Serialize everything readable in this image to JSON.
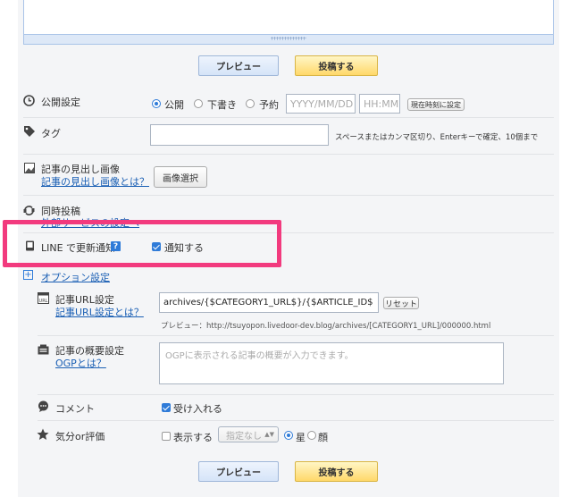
{
  "buttons": {
    "preview": "プレビュー",
    "post": "投稿する"
  },
  "publish": {
    "label": "公開設定",
    "options": [
      "公開",
      "下書き",
      "予約"
    ],
    "selected": "公開",
    "date_placeholder": "YYYY/MM/DD",
    "time_placeholder": "HH:MM",
    "now_button": "現在時刻に設定"
  },
  "tag": {
    "label": "タグ",
    "value": "",
    "hint": "スペースまたはカンマ区切り、Enterキーで確定、10個まで"
  },
  "heading_image": {
    "label": "記事の見出し画像",
    "link": "記事の見出し画像とは？",
    "button": "画像選択"
  },
  "sync_post": {
    "label": "同時投稿",
    "link": "外部サービスの設定へ"
  },
  "line": {
    "label": "LINE で更新通知",
    "help": "?",
    "checkbox_label": "通知する",
    "checked": true
  },
  "options": {
    "toggle": "+",
    "link": "オプション設定"
  },
  "article_url": {
    "label": "記事URL設定",
    "link": "記事URL設定とは？",
    "value": "archives/{$CATEGORY1_URL$}/{$ARTICLE_ID$",
    "reset": "リセット",
    "preview": "プレビュー：http://tsuyopon.livedoor-dev.blog/archives/[CATEGORY1_URL]/000000.html"
  },
  "summary": {
    "label": "記事の概要設定",
    "link": "OGPとは？",
    "placeholder": "OGPに表示される記事の概要が入力できます。"
  },
  "comment": {
    "label": "コメント",
    "checkbox_label": "受け入れる",
    "checked": true
  },
  "rating": {
    "label": "気分or評価",
    "show_label": "表示する",
    "select_value": "指定なし",
    "options": [
      "星",
      "顔"
    ],
    "selected": "星"
  },
  "colors": {
    "accent": "#2f7bd8",
    "highlight": "#f23a7e",
    "link": "#1a5fb4"
  }
}
